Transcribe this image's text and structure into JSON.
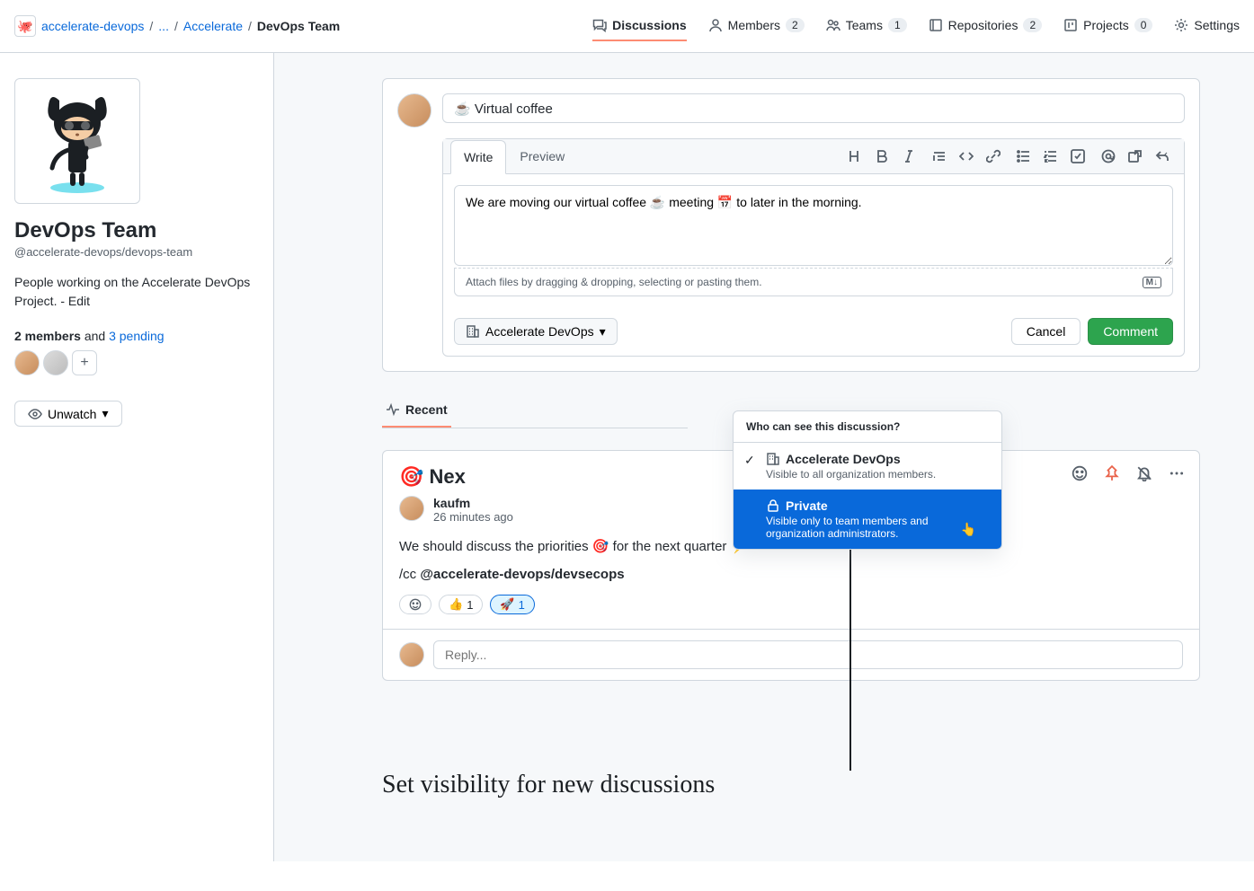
{
  "breadcrumb": {
    "org": "accelerate-devops",
    "ellipsis": "...",
    "team_parent": "Accelerate",
    "team": "DevOps Team"
  },
  "nav": {
    "discussions": "Discussions",
    "members": "Members",
    "members_count": "2",
    "teams": "Teams",
    "teams_count": "1",
    "repos": "Repositories",
    "repos_count": "2",
    "projects": "Projects",
    "projects_count": "0",
    "settings": "Settings"
  },
  "sidebar": {
    "title": "DevOps Team",
    "slug": "@accelerate-devops/devops-team",
    "description": "People working on the Accelerate DevOps Project. - Edit",
    "members_label": "2 members",
    "and": " and ",
    "pending": "3 pending",
    "unwatch": "Unwatch"
  },
  "compose": {
    "title_value": "☕ Virtual coffee",
    "tab_write": "Write",
    "tab_preview": "Preview",
    "body": "We are moving our virtual coffee ☕ meeting 📅 to later in the morning.",
    "attach_hint": "Attach files by dragging & dropping, selecting or pasting them.",
    "md_badge": "M↓",
    "visibility_label": "Accelerate DevOps",
    "cancel": "Cancel",
    "comment": "Comment"
  },
  "visibility_menu": {
    "header": "Who can see this discussion?",
    "opt1_title": "Accelerate DevOps",
    "opt1_desc": "Visible to all organization members.",
    "opt2_title": "Private",
    "opt2_desc": "Visible only to team members and organization administrators."
  },
  "subnav": {
    "recent": "Recent"
  },
  "post": {
    "title": "🎯 Nex",
    "author": "kaufm",
    "time": "26 minutes ago",
    "body": "We should discuss the priorities 🎯 for the next quarter ⚡",
    "cc_prefix": "/cc ",
    "cc_handle": "@accelerate-devops/devsecops",
    "react_thumb": "👍",
    "react_thumb_n": "1",
    "react_rocket": "🚀",
    "react_rocket_n": "1",
    "reply_placeholder": "Reply..."
  },
  "caption": "Set visibility for new discussions"
}
